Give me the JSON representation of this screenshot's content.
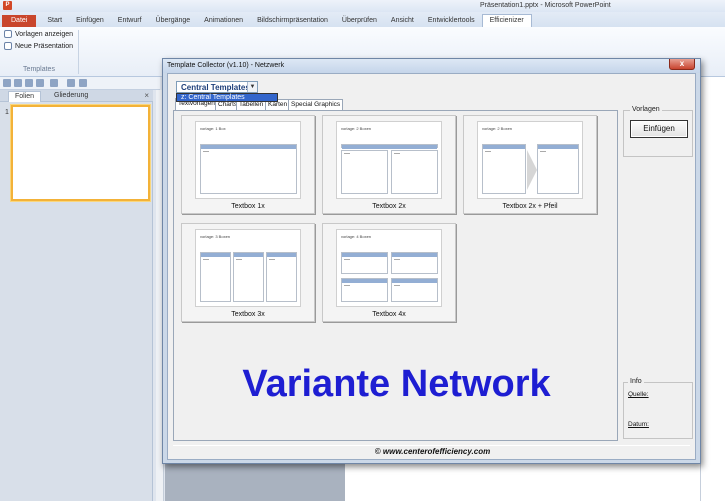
{
  "app": {
    "title": "Präsentation1.pptx - Microsoft PowerPoint",
    "icon_label": "P"
  },
  "ribbon": {
    "tabs": [
      "Datei",
      "Start",
      "Einfügen",
      "Entwurf",
      "Übergänge",
      "Animationen",
      "Bildschirmpräsentation",
      "Überprüfen",
      "Ansicht",
      "Entwicklertools",
      "Efficienizer"
    ],
    "active_tab": "Efficienizer",
    "group": {
      "items": [
        "Vorlagen anzeigen",
        "Neue Präsentation"
      ],
      "label": "Templates"
    }
  },
  "side_panel": {
    "tabs": [
      "Folien",
      "Gliederung"
    ],
    "close": "×",
    "slide_number": "1"
  },
  "dialog": {
    "title": "Template Collector (v1.10) - Netzwerk",
    "close": "x",
    "dropdown": {
      "value": "Central Templates",
      "arrow": "▼",
      "option": "z:  Central Templates"
    },
    "tabs": [
      "Textvorlagen",
      "Charts",
      "Tabellen",
      "Karten",
      "Special Graphics"
    ],
    "cards": [
      {
        "label": "Textbox 1x",
        "thumb_title": "vorlage: 1 Box",
        "box_head": "Überschrift"
      },
      {
        "label": "Textbox 2x",
        "thumb_title": "vorlage: 2 Boxen",
        "box_head": "Überschrift"
      },
      {
        "label": "Textbox 2x + Pfeil",
        "thumb_title": "vorlage: 2 Boxen",
        "box_head": "Überschrift"
      },
      {
        "label": "Textbox 3x",
        "thumb_title": "vorlage: 3 Boxen",
        "box_head": "Überschrift"
      },
      {
        "label": "Textbox 4x",
        "thumb_title": "vorlage: 4 Boxen",
        "box_head": "Überschrift"
      }
    ],
    "overlay_text": "Variante Network",
    "groups": {
      "vorlagen": {
        "legend": "Vorlagen",
        "button": "Einfügen"
      },
      "info": {
        "legend": "Info",
        "source_label": "Quelle:",
        "date_label": "Datum:"
      }
    },
    "footer": "© www.centerofefficiency.com"
  }
}
